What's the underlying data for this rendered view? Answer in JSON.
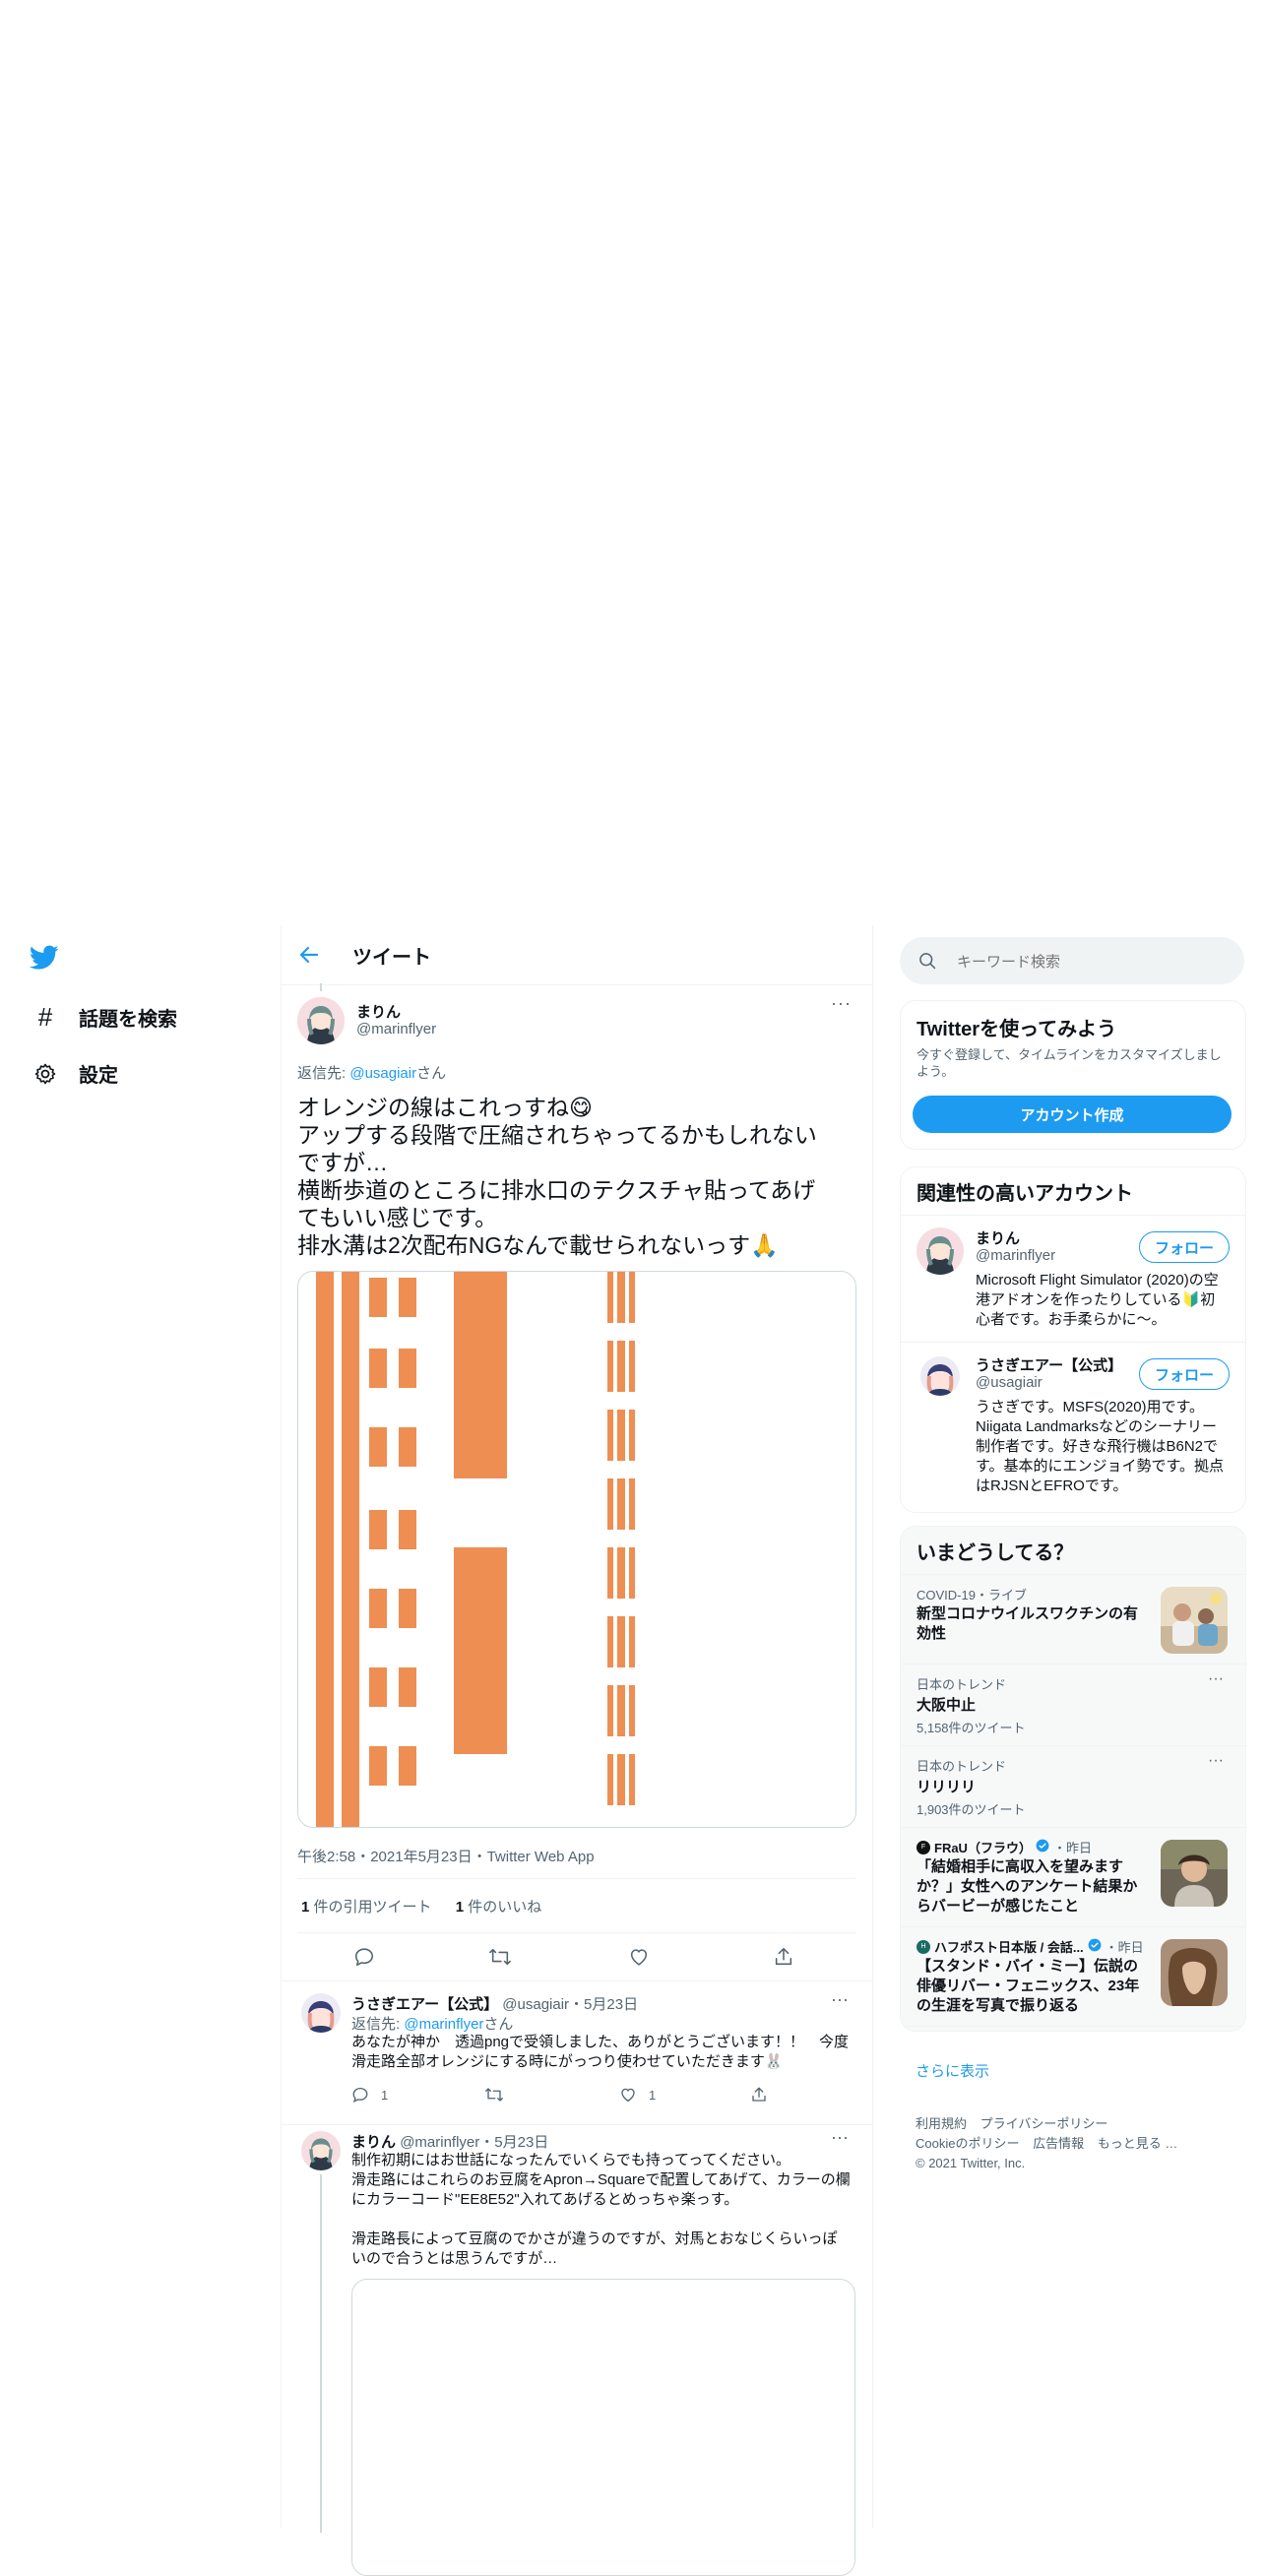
{
  "nav": {
    "explore_label": "話題を検索",
    "settings_label": "設定"
  },
  "header": {
    "title": "ツイート"
  },
  "tweet": {
    "author_name": "まりん",
    "author_handle": "@marinflyer",
    "reply_to_prefix": "返信先: ",
    "reply_to_handle": "@usagiair",
    "reply_to_suffix": "さん",
    "text_lines": [
      "オレンジの線はこれっすね😋",
      "アップする段階で圧縮されちゃってるかもしれない",
      "ですが…",
      "横断歩道のところに排水口のテクスチャ貼ってあげ",
      "てもいい感じです。",
      "排水溝は2次配布NGなんで載せられないっす🙏"
    ],
    "meta": "午後2:58・2021年5月23日・Twitter Web App",
    "quote_count": "1",
    "quote_label": "件の引用ツイート",
    "like_count": "1",
    "like_label": "件のいいね",
    "image_color": "#EE8E52"
  },
  "replies": [
    {
      "name": "うさぎエアー【公式】",
      "handle": "@usagiair",
      "date": "・5月23日",
      "reply_prefix": "返信先: ",
      "reply_handle": "@marinflyer",
      "reply_suffix": "さん",
      "lines": [
        "あなたが神か　透過pngで受領しました、ありがとうございます！！　今度",
        "滑走路全部オレンジにする時にがっつり使わせていただきます🐰"
      ],
      "reply_count": "1",
      "retweet_count": "",
      "like_count": "1"
    },
    {
      "name": "まりん",
      "handle": "@marinflyer",
      "date": "・5月23日",
      "lines": [
        "制作初期にはお世話になったんでいくらでも持ってってください。",
        "滑走路にはこれらのお豆腐をApron→Squareで配置してあげて、カラーの欄",
        "にカラーコード\"EE8E52\"入れてあげるとめっちゃ楽っす。",
        "",
        "滑走路長によって豆腐のでかさが違うのですが、対馬とおなじくらいっぽ",
        "いので合うとは思うんですが…"
      ]
    }
  ],
  "search": {
    "placeholder": "キーワード検索"
  },
  "signup": {
    "title": "Twitterを使ってみよう",
    "desc_line1": "今すぐ登録して、タイムラインをカスタマイズしまし",
    "desc_line2": "よう。",
    "button": "アカウント作成"
  },
  "related": {
    "title": "関連性の高いアカウント",
    "accounts": [
      {
        "name": "まりん",
        "handle": "@marinflyer",
        "follow": "フォロー",
        "bio_lines": [
          "Microsoft Flight Simulator (2020)の空",
          "港アドオンを作ったりしている🔰初",
          "心者です。お手柔らかに〜。"
        ]
      },
      {
        "name": "うさぎエアー【公式】",
        "handle": "@usagiair",
        "follow": "フォロー",
        "bio_lines": [
          "うさぎです。MSFS(2020)用です。",
          "Niigata Landmarksなどのシーナリー",
          "制作者です。好きな飛行機はB6N2で",
          "す。基本的にエンジョイ勢です。拠点",
          "はRJSNとEFROです。"
        ]
      }
    ]
  },
  "trends": {
    "title": "いまどうしてる？",
    "items": [
      {
        "context": "COVID-19・ライブ",
        "title_lines": [
          "新型コロナウイルスワクチンの有",
          "効性"
        ]
      },
      {
        "context": "日本のトレンド",
        "title_lines": [
          "大阪中止"
        ],
        "count": "5,158件のツイート"
      },
      {
        "context": "日本のトレンド",
        "title_lines": [
          "リリリリ"
        ],
        "count": "1,903件のツイート"
      },
      {
        "source": "FRaU（フラウ）",
        "time": "・昨日",
        "title_lines": [
          "「結婚相手に高収入を望みます",
          "か？」女性へのアンケート結果か",
          "らバービーが感じたこと"
        ]
      },
      {
        "source": "ハフポスト日本版 / 会話...",
        "time": "・昨日",
        "title_lines": [
          "【スタンド・バイ・ミー】伝説の",
          "俳優リバー・フェニックス、23年",
          "の生涯を写真で振り返る"
        ]
      }
    ],
    "show_more": "さらに表示"
  },
  "footer": {
    "links_row1": [
      "利用規約",
      "プライバシーポリシー"
    ],
    "links_row2": [
      "Cookieのポリシー",
      "広告情報",
      "もっと見る …"
    ],
    "copyright": "© 2021 Twitter, Inc."
  }
}
